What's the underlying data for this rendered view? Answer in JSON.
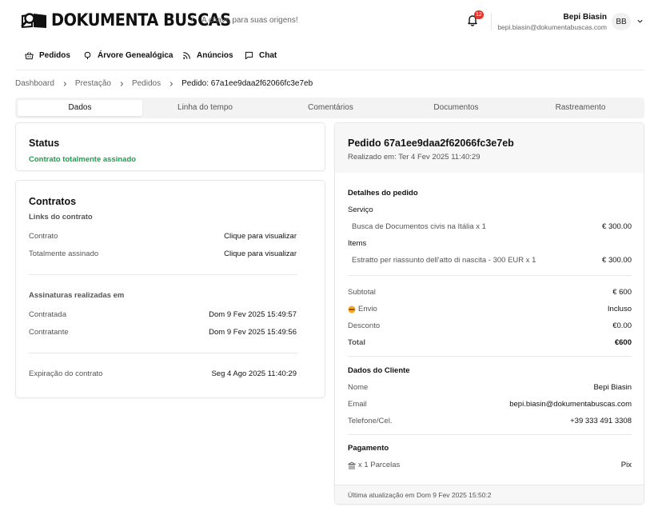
{
  "header": {
    "brand": "DOKUMENTA BUSCAS",
    "slogan_sep": "/",
    "slogan": "A chave para suas origens!",
    "notifications_count": "12",
    "user_name": "Bepi Biasin",
    "user_email": "bepi.biasin@dokumentabuscas.com",
    "avatar_initials": "BB"
  },
  "nav": [
    {
      "label": "Pedidos",
      "icon": "basket-icon"
    },
    {
      "label": "Árvore Genealógica",
      "icon": "tree-icon"
    },
    {
      "label": "Anúncios",
      "icon": "rss-icon"
    },
    {
      "label": "Chat",
      "icon": "chat-icon"
    }
  ],
  "breadcrumb": {
    "items": [
      "Dashboard",
      "Prestação",
      "Pedidos"
    ],
    "current": "Pedido: 67a1ee9daa2f62066fc3e7eb"
  },
  "tabs": [
    "Dados",
    "Linha do tempo",
    "Comentários",
    "Documentos",
    "Rastreamento"
  ],
  "status": {
    "title": "Status",
    "value": "Contrato totalmente assinado",
    "value_color": "#16a34a"
  },
  "contracts": {
    "title": "Contratos",
    "links_heading": "Links do contrato",
    "links": [
      {
        "label": "Contrato",
        "value": "Clique para visualizar"
      },
      {
        "label": "Totalmente assinado",
        "value": "Clique para visualizar"
      }
    ],
    "signatures_heading": "Assinaturas realizadas em",
    "signatures": [
      {
        "label": "Contratada",
        "value": "Dom 9 Fev 2025 15:49:57"
      },
      {
        "label": "Contratante",
        "value": "Dom 9 Fev 2025 15:49:56"
      }
    ],
    "expiration_label": "Expiração do contrato",
    "expiration_value": "Seg 4 Ago 2025 11:40:29"
  },
  "order": {
    "title": "Pedido 67a1ee9daa2f62066fc3e7eb",
    "placed": "Realizado em: Ter 4 Fev 2025 11:40:29",
    "details_heading": "Detalhes do pedido",
    "service_heading": "Serviço",
    "service_item": "Busca de Documentos civis na Itália x 1",
    "service_price": "€ 300.00",
    "items_heading": "Items",
    "item": "Estratto per riassunto dell'atto di nascita - 300 EUR x 1",
    "item_price": "€ 300.00",
    "subtotal_label": "Subtotal",
    "subtotal_value": "€ 600",
    "shipping_label": "Envio",
    "shipping_value": "Incluso",
    "discount_label": "Desconto",
    "discount_value": "€0.00",
    "total_label": "Total",
    "total_value": "€600",
    "client_heading": "Dados do Cliente",
    "client": [
      {
        "label": "Nome",
        "value": "Bepi Biasin"
      },
      {
        "label": "Email",
        "value": "bepi.biasin@dokumentabuscas.com"
      },
      {
        "label": "Telefone/Cel.",
        "value": "+39 333 491 3308"
      }
    ],
    "payment_heading": "Pagamento",
    "payment_label": "x 1 Parcelas",
    "payment_value": "Pix",
    "footer": "Última atualização em Dom 9 Fev 2025 15:50:2"
  }
}
